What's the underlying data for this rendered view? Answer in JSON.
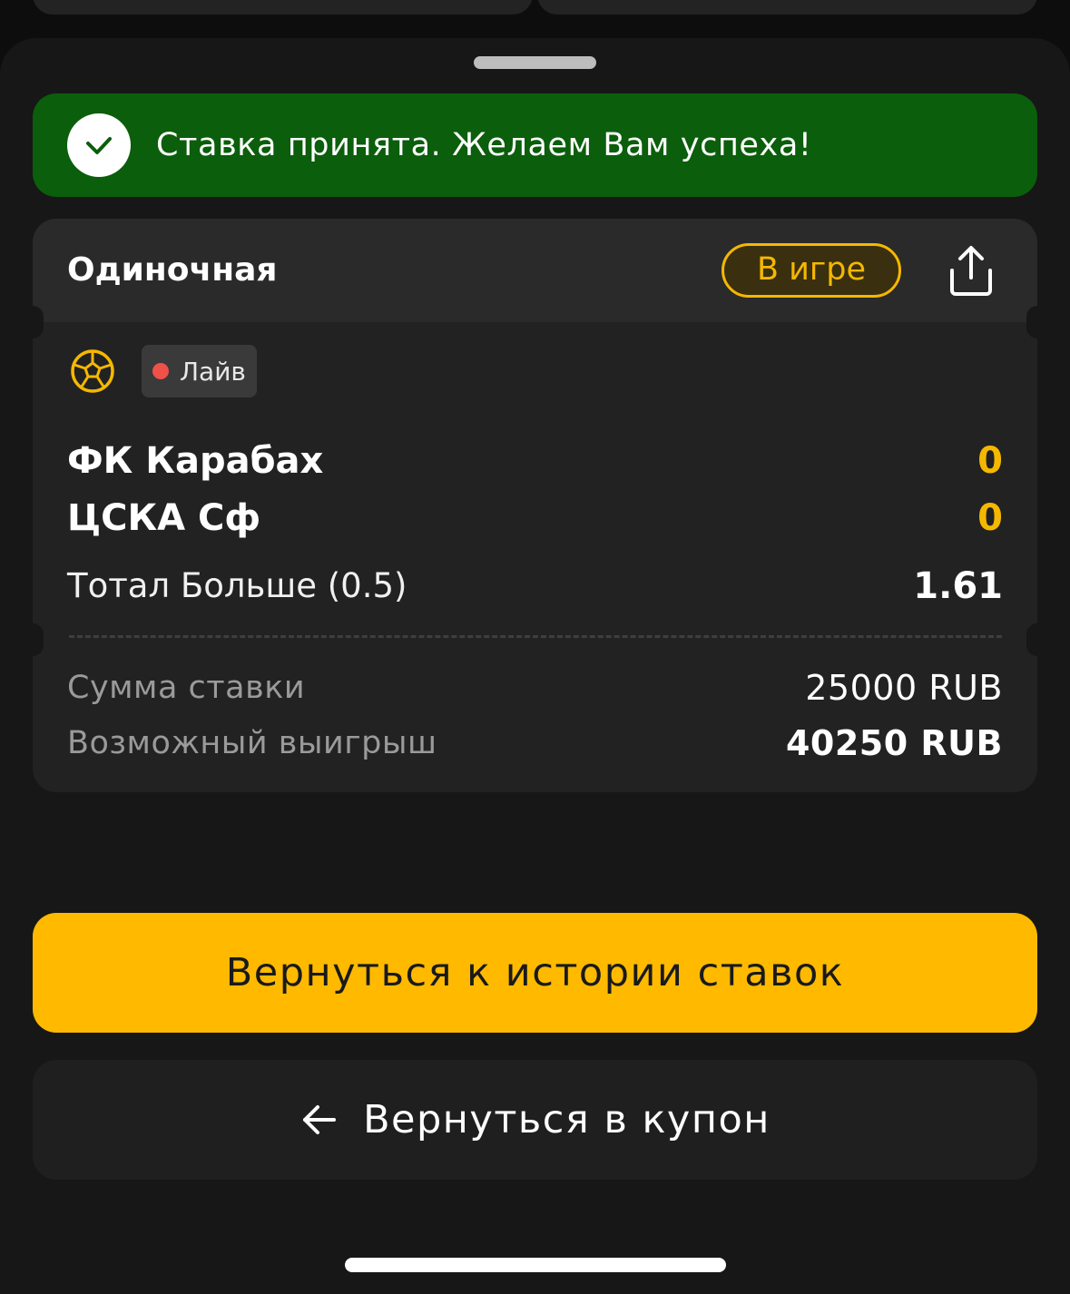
{
  "banner": {
    "message": "Ставка принята. Желаем Вам успеха!",
    "icon": "check-icon",
    "color": "#0b5e0b"
  },
  "bet": {
    "type": "Одиночная",
    "status": "В игре",
    "share_icon": "share-icon",
    "sport_icon": "soccer-ball-icon",
    "live_label": "Лайв",
    "home_team": "ФК Карабах",
    "home_score": "0",
    "away_team": "ЦСКА Сф",
    "away_score": "0",
    "market": "Тотал Больше (0.5)",
    "odds": "1.61"
  },
  "summary": {
    "stake_label": "Сумма ставки",
    "stake_value": "25000 RUB",
    "win_label": "Возможный выигрыш",
    "win_value": "40250 RUB"
  },
  "actions": {
    "history_label": "Вернуться к истории ставок",
    "coupon_label": "Вернуться в купон",
    "back_icon": "arrow-left-icon"
  },
  "colors": {
    "accent": "#ffba00",
    "status_accent": "#f5b800",
    "live_dot": "#f0504a"
  }
}
